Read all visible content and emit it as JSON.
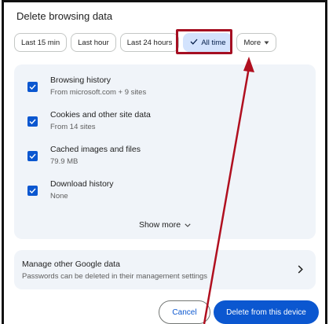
{
  "dialog": {
    "title": "Delete browsing data"
  },
  "time_range": {
    "chips": [
      {
        "label": "Last 15 min",
        "selected": false
      },
      {
        "label": "Last hour",
        "selected": false
      },
      {
        "label": "Last 24 hours",
        "selected": false
      },
      {
        "label": "All time",
        "selected": true,
        "icon": "check-icon"
      },
      {
        "label": "More",
        "selected": false,
        "icon": "dropdown-triangle-icon"
      }
    ]
  },
  "data_types": {
    "items": [
      {
        "title": "Browsing history",
        "subtitle": "From microsoft.com + 9 sites",
        "checked": true
      },
      {
        "title": "Cookies and other site data",
        "subtitle": "From 14 sites",
        "checked": true
      },
      {
        "title": "Cached images and files",
        "subtitle": "79.9 MB",
        "checked": true
      },
      {
        "title": "Download history",
        "subtitle": "None",
        "checked": true
      }
    ],
    "show_more_label": "Show more"
  },
  "manage_google_data": {
    "title": "Manage other Google data",
    "subtitle": "Passwords can be deleted in their management settings",
    "icon": "chevron-right-icon"
  },
  "actions": {
    "cancel_label": "Cancel",
    "delete_label": "Delete from this device"
  },
  "annotation": {
    "highlight_color": "#a50f22",
    "arrow_color": "#b00f1f"
  },
  "colors": {
    "accent": "#0b57d0",
    "selected_chip_bg": "#d3e3fd",
    "panel_bg": "#f0f4f9"
  }
}
